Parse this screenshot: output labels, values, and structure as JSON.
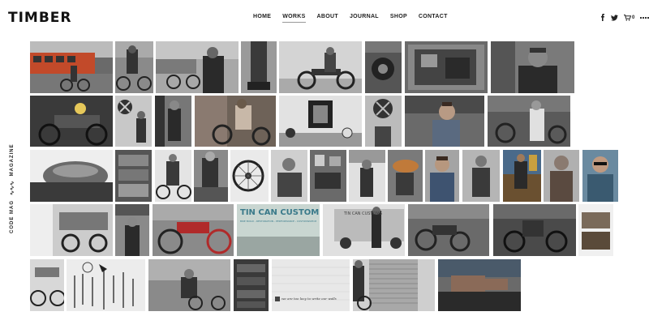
{
  "brand": "TIMBER",
  "nav": {
    "home": "HOME",
    "works": "WORKS",
    "about": "ABOUT",
    "journal": "JOURNAL",
    "shop": "SHOP",
    "contact": "CONTACT"
  },
  "icons": {
    "facebook": "f",
    "twitter": "t-bird",
    "cart": "cart",
    "cart_count": "0",
    "grid": "grid"
  },
  "sidebar": {
    "left": "CODE MAG",
    "right": "MAGAZINE"
  },
  "photos": {
    "sign_text": "TIN CAN CUSTOMS",
    "sign_subtext": "BIKE BUILD - RESTORATION - PERFORMANCE - CUSTOMIZATION",
    "van_text": "TIN CAN CUSTOMS",
    "wall_text": "we are too lazy to write our walls"
  }
}
